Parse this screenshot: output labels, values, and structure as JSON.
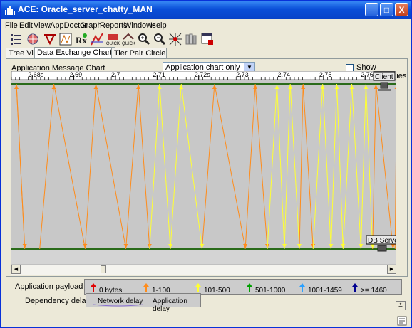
{
  "window": {
    "title": "ACE: Oracle_server_chatty_MAN",
    "minimize": "_",
    "maximize": "□",
    "close": "X"
  },
  "menu": [
    "File",
    "Edit",
    "View",
    "AppDoctor",
    "Graph",
    "Reports",
    "Windows",
    "Help"
  ],
  "toolbar": [
    "tree-view-tool-icon",
    "globe-tool-icon",
    "filter-tool-icon",
    "data-exchange-tool-icon",
    "rx-tool-icon",
    "chart-tool-icon",
    "quick-tool-icon",
    "quick-compare-tool-icon",
    "zoom-in-tool-icon",
    "zoom-out-tool-icon",
    "network-tool-icon",
    "books-tool-icon",
    "window-tool-icon"
  ],
  "tabs": [
    "Tree View",
    "Data Exchange Chart",
    "Tier Pair Circle"
  ],
  "active_tab": "Data Exchange Chart",
  "chart_header": {
    "label": "Application Message Chart",
    "select_value": "Application chart only",
    "checkbox_label": "Show Dependencies",
    "checkbox_checked": false
  },
  "chart_data": {
    "type": "line",
    "xlabel": "",
    "ylabel": "",
    "xlim": [
      2.675,
      2.7675
    ],
    "ticks": [
      "2.68s",
      "2.69",
      "2.7",
      "2.71",
      "2.72s",
      "2.73",
      "2.74",
      "2.75",
      "2.76s"
    ],
    "tick_values": [
      2.68,
      2.69,
      2.7,
      2.71,
      2.72,
      2.73,
      2.74,
      2.75,
      2.76
    ],
    "top_label": "Client",
    "bottom_label": "DB Server",
    "series": [
      {
        "direction": "up",
        "color": "#ff8c1a",
        "segments": [
          [
            2.6782,
            2.6762
          ],
          [
            2.6818,
            2.6852
          ],
          [
            2.6927,
            2.6953
          ],
          [
            2.7025,
            2.7055
          ],
          [
            2.7208,
            2.7238
          ],
          [
            2.7312,
            2.7336
          ],
          [
            2.7442,
            2.7451
          ],
          [
            2.7618,
            2.7626
          ],
          [
            2.7672,
            2.7676
          ]
        ]
      },
      {
        "direction": "down",
        "color": "#ff8c1a",
        "segments": [
          [
            2.6762,
            2.6782
          ],
          [
            2.6852,
            2.6927
          ],
          [
            2.6953,
            2.7025
          ],
          [
            2.7055,
            2.7082
          ],
          [
            2.7238,
            2.7312
          ],
          [
            2.7336,
            2.7365
          ],
          [
            2.7451,
            2.7475
          ],
          [
            2.7626,
            2.7667
          ]
        ]
      },
      {
        "direction": "up",
        "color": "#ffff33",
        "segments": [
          [
            2.7082,
            2.7106
          ],
          [
            2.7132,
            2.7158
          ],
          [
            2.7365,
            2.7388
          ],
          [
            2.7406,
            2.742
          ],
          [
            2.7475,
            2.7498
          ],
          [
            2.7518,
            2.7532
          ],
          [
            2.7547,
            2.7568
          ],
          [
            2.759,
            2.7602
          ]
        ]
      },
      {
        "direction": "down",
        "color": "#ffff33",
        "segments": [
          [
            2.7106,
            2.7132
          ],
          [
            2.7158,
            2.7208
          ],
          [
            2.7388,
            2.7406
          ],
          [
            2.742,
            2.7442
          ],
          [
            2.7498,
            2.7518
          ],
          [
            2.7532,
            2.7547
          ],
          [
            2.7568,
            2.759
          ],
          [
            2.7602,
            2.7618
          ]
        ]
      }
    ]
  },
  "legend": {
    "payload_label": "Application payload size:",
    "items": [
      {
        "label": "0 bytes",
        "color": "#e00000"
      },
      {
        "label": "1-100",
        "color": "#ff8c1a"
      },
      {
        "label": "101-500",
        "color": "#ffff33"
      },
      {
        "label": "501-1000",
        "color": "#00a000"
      },
      {
        "label": "1001-1459",
        "color": "#2aa0ff"
      },
      {
        "label": ">= 1460",
        "color": "#000090"
      }
    ],
    "delay_label": "Dependency delays:",
    "network_delay": "Network delay",
    "application_delay": "Application delay"
  }
}
